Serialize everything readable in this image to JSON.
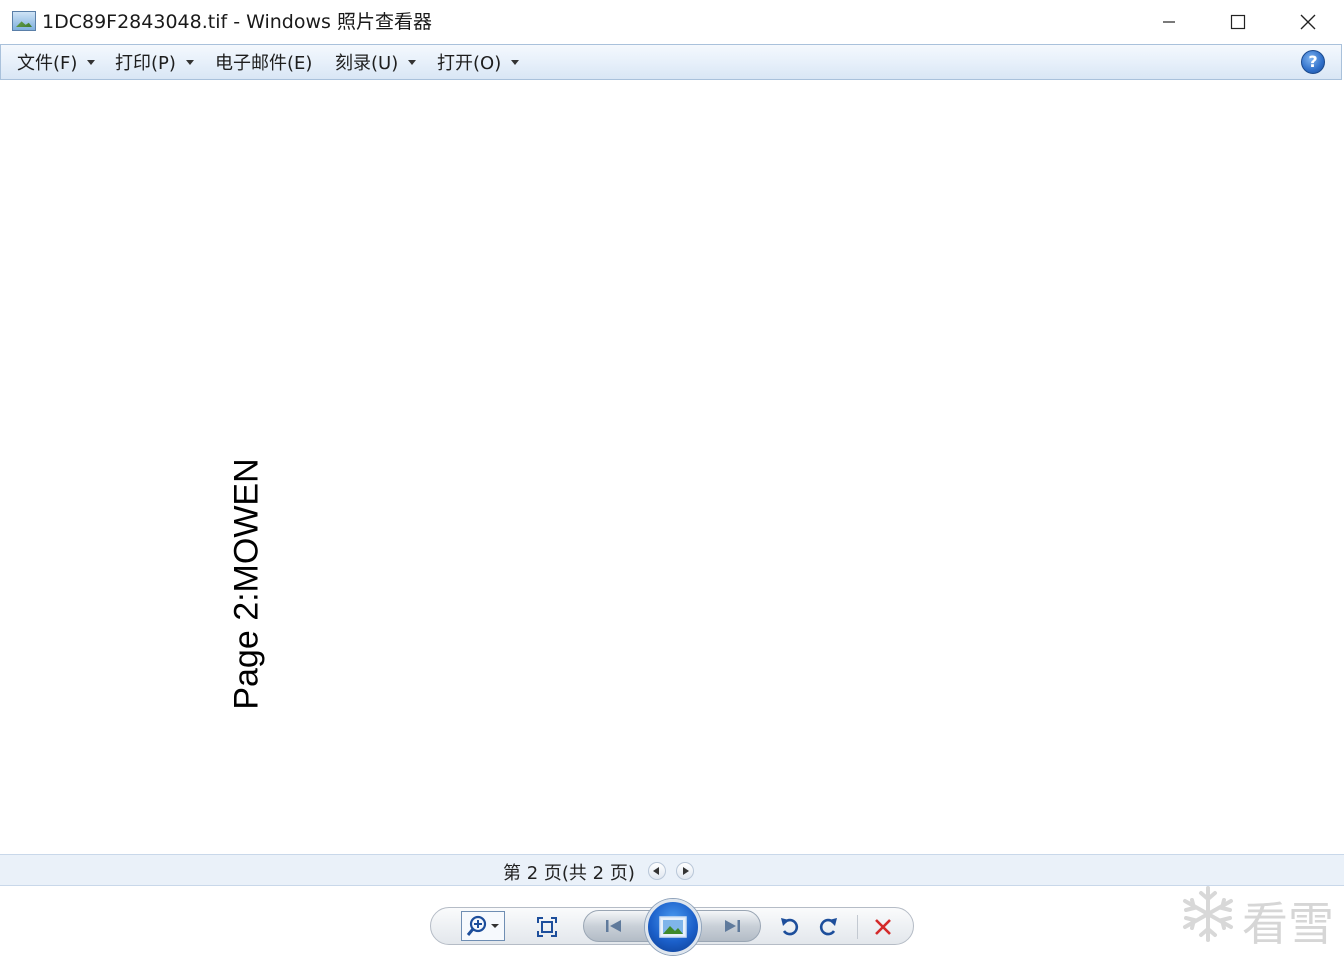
{
  "window": {
    "title": "1DC89F2843048.tif - Windows 照片查看器"
  },
  "menu": {
    "items": [
      {
        "label": "文件(F)",
        "has_dropdown": true
      },
      {
        "label": "打印(P)",
        "has_dropdown": true
      },
      {
        "label": "电子邮件(E)",
        "has_dropdown": false
      },
      {
        "label": "刻录(U)",
        "has_dropdown": true
      },
      {
        "label": "打开(O)",
        "has_dropdown": true
      }
    ],
    "help_label": "?"
  },
  "image": {
    "text": "Page 2:MOWEN",
    "rotation": "rotated 90° counter-clockwise"
  },
  "page_bar": {
    "status": "第 2 页(共 2 页)"
  },
  "toolbar": {
    "buttons": [
      "zoom",
      "fit-to-window",
      "previous",
      "slideshow",
      "next",
      "rotate-counterclockwise",
      "rotate-clockwise",
      "delete"
    ]
  },
  "watermark": {
    "text": "看雪"
  },
  "colors": {
    "menubar_bg": "#e7f0fa",
    "accent_blue": "#1b5fc9",
    "delete_red": "#d42a2a"
  }
}
